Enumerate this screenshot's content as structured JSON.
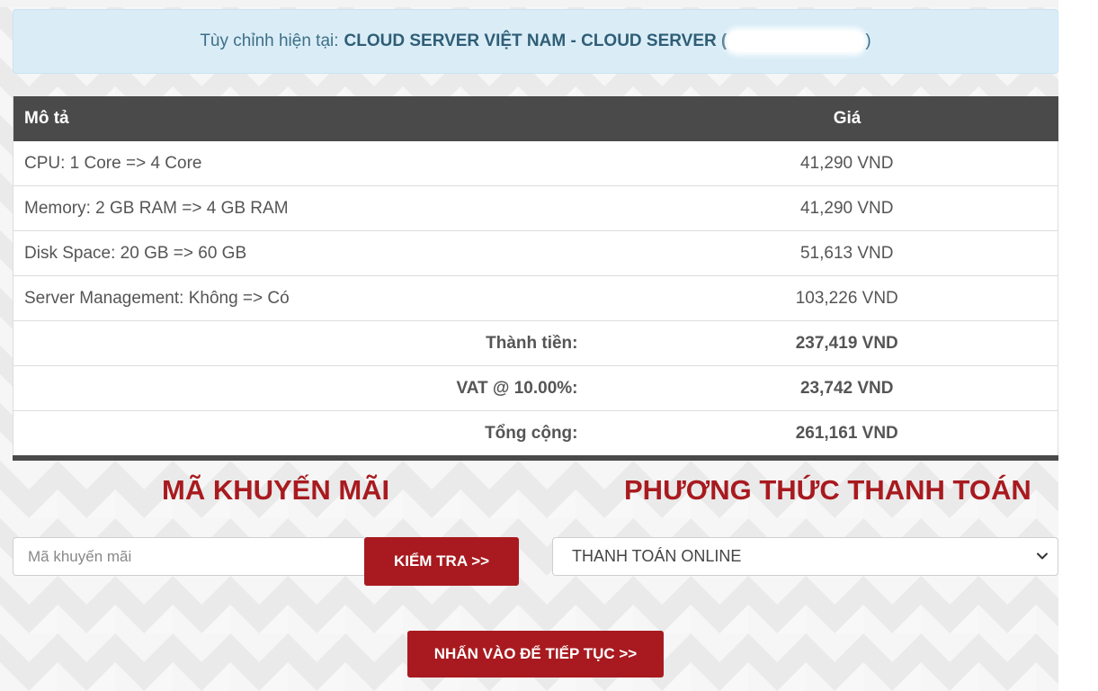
{
  "info": {
    "prefix": "Tùy chỉnh hiện tại:",
    "product": "CLOUD SERVER VIỆT NAM - CLOUD SERVER (",
    "suffix": ")"
  },
  "table": {
    "headers": {
      "description": "Mô tả",
      "price": "Giá"
    },
    "rows": [
      {
        "desc": "CPU: 1 Core => 4 Core",
        "price": "41,290 VND"
      },
      {
        "desc": "Memory: 2 GB RAM => 4 GB RAM",
        "price": "41,290 VND"
      },
      {
        "desc": "Disk Space: 20 GB => 60 GB",
        "price": "51,613 VND"
      },
      {
        "desc": "Server Management: Không => Có",
        "price": "103,226 VND"
      }
    ],
    "subtotal": {
      "label": "Thành tiền:",
      "value": "237,419 VND"
    },
    "vat": {
      "label": "VAT @ 10.00%:",
      "value": "23,742 VND"
    },
    "total": {
      "label": "Tổng cộng:",
      "value": "261,161 VND"
    }
  },
  "promo": {
    "title": "MÃ KHUYẾN MÃI",
    "placeholder": "Mã khuyến mãi",
    "value": "",
    "button_label": "KIỂM TRA >>"
  },
  "payment": {
    "title": "PHƯƠNG THỨC THANH TOÁN",
    "selected": "THANH TOÁN ONLINE",
    "icon": "chevron-down-icon"
  },
  "continue_label": "NHẤN VÀO ĐỂ TIẾP TỤC >>",
  "colors": {
    "accent": "#a81a1f",
    "info_bg": "#daedf7",
    "info_text": "#3d6f87",
    "table_header": "#4b4a4a"
  }
}
